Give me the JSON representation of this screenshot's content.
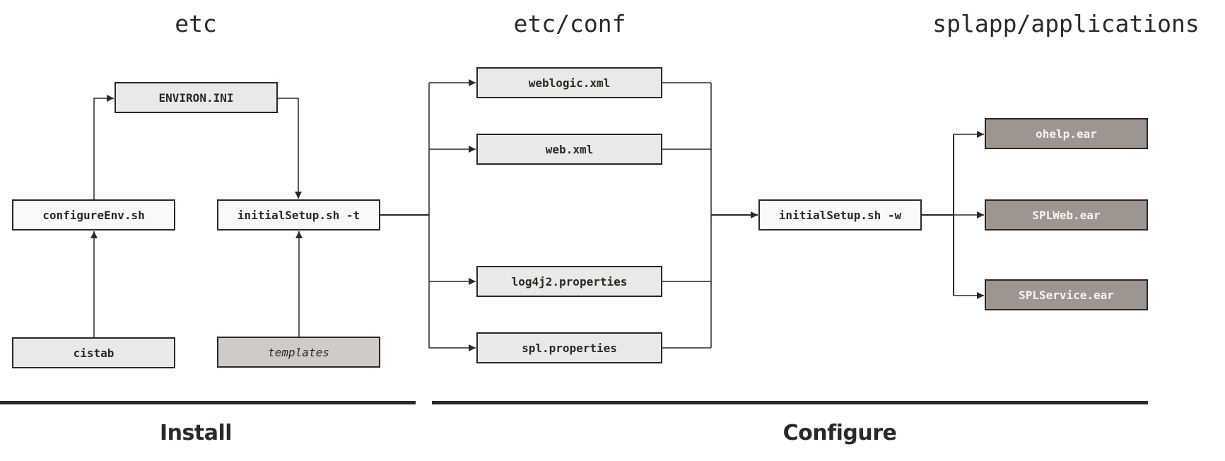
{
  "columns": {
    "etc": "etc",
    "etc_conf": "etc/conf",
    "splapp": "splapp/applications"
  },
  "phases": {
    "install": "Install",
    "configure": "Configure"
  },
  "nodes": {
    "environ_ini": "ENVIRON.INI",
    "configure_env": "configureEnv.sh",
    "initial_setup_t": "initialSetup.sh -t",
    "cistab": "cistab",
    "templates": "templates",
    "weblogic_xml": "weblogic.xml",
    "web_xml": "web.xml",
    "log4j2_properties": "log4j2.properties",
    "spl_properties": "spl.properties",
    "initial_setup_w": "initialSetup.sh -w",
    "ohelp_ear": "ohelp.ear",
    "splweb_ear": "SPLWeb.ear",
    "splservice_ear": "SPLService.ear"
  },
  "colors": {
    "line": "#2b2825",
    "box_light": "#ebe9e7",
    "box_white": "#faf9f8",
    "box_mid": "#cfcbc7",
    "box_dark": "#9d958f"
  }
}
